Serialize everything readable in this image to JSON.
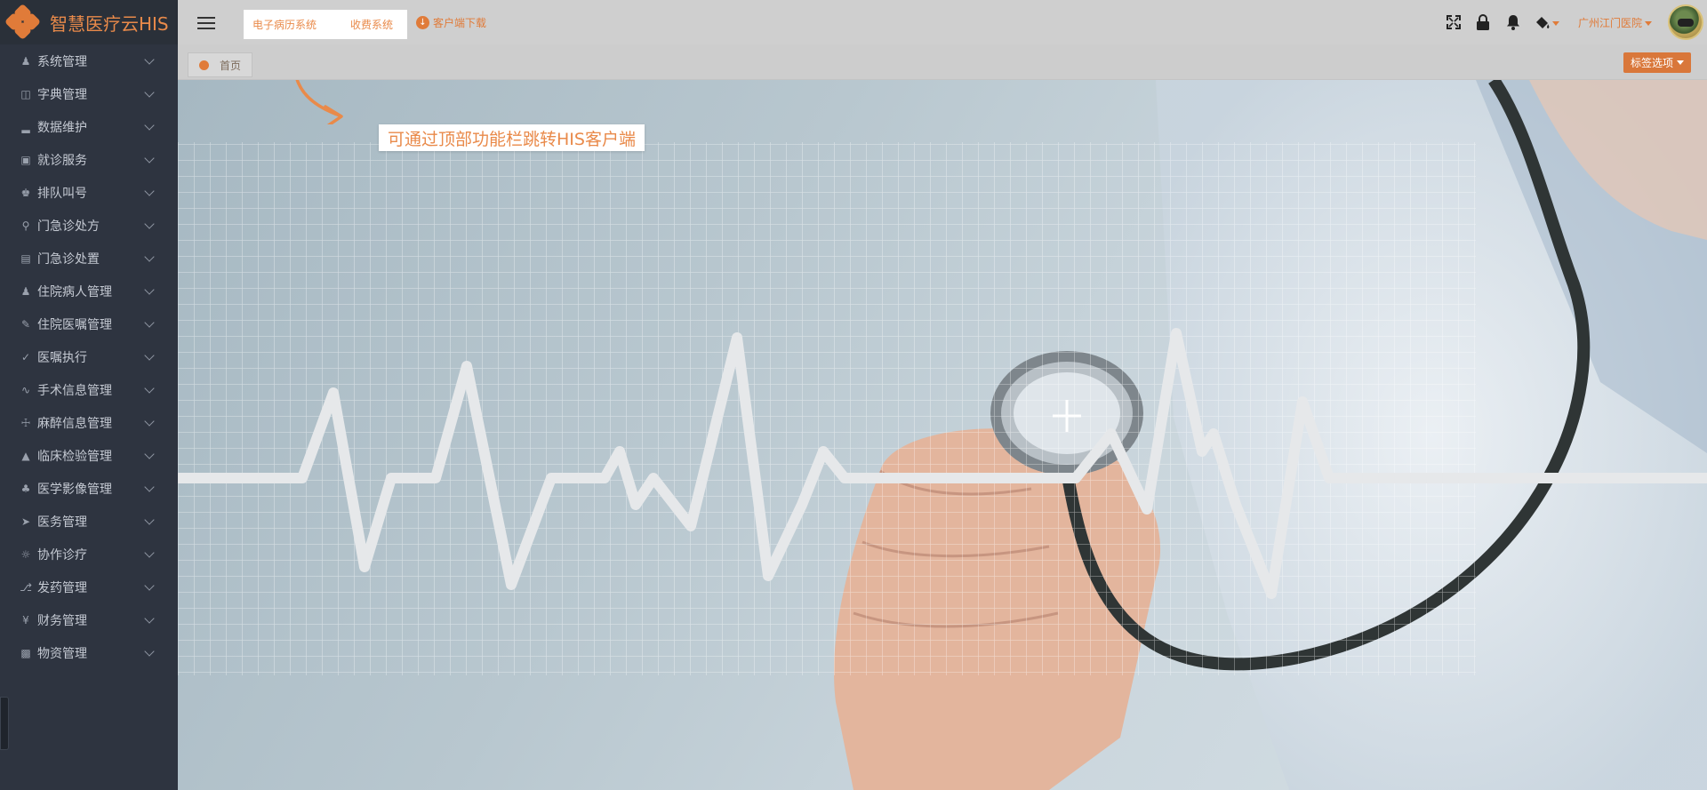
{
  "app": {
    "title": "智慧医疗云HIS"
  },
  "sidebar": {
    "items": [
      {
        "label": "系统管理",
        "icon": "users-icon"
      },
      {
        "label": "字典管理",
        "icon": "book-icon"
      },
      {
        "label": "数据维护",
        "icon": "bar-chart-icon"
      },
      {
        "label": "就诊服务",
        "icon": "briefcase-icon"
      },
      {
        "label": "排队叫号",
        "icon": "queue-icon"
      },
      {
        "label": "门急诊处方",
        "icon": "fork-icon"
      },
      {
        "label": "门急诊处置",
        "icon": "clipboard-icon"
      },
      {
        "label": "住院病人管理",
        "icon": "user-plus-icon"
      },
      {
        "label": "住院医嘱管理",
        "icon": "edit-icon"
      },
      {
        "label": "医嘱执行",
        "icon": "check-icon"
      },
      {
        "label": "手术信息管理",
        "icon": "pulse-icon"
      },
      {
        "label": "麻醉信息管理",
        "icon": "person-icon"
      },
      {
        "label": "临床检验管理",
        "icon": "flask-icon"
      },
      {
        "label": "医学影像管理",
        "icon": "molecule-icon"
      },
      {
        "label": "医务管理",
        "icon": "send-icon"
      },
      {
        "label": "协作诊疗",
        "icon": "sun-icon"
      },
      {
        "label": "发药管理",
        "icon": "flow-icon"
      },
      {
        "label": "财务管理",
        "icon": "yen-icon"
      },
      {
        "label": "物资管理",
        "icon": "box-icon"
      }
    ]
  },
  "header": {
    "systems": [
      "电子病历系统",
      "收费系统"
    ],
    "download": "客户端下载",
    "hospital": "广州江门医院"
  },
  "tabs": {
    "home": "首页",
    "options": "标签选项"
  },
  "main": {
    "callout": "可通过顶部功能栏跳转HIS客户端"
  },
  "colors": {
    "accent": "#e07b39",
    "sidebar": "#2e3440"
  }
}
